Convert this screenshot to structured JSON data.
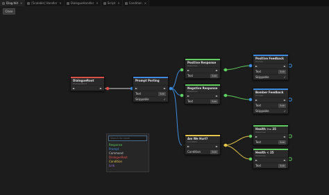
{
  "tabs": [
    {
      "label": "Diag.tkit",
      "active": true
    },
    {
      "label": "[Scalable] Handler",
      "active": false
    },
    {
      "label": "DialogueHandler",
      "active": false
    },
    {
      "label": "Script",
      "active": false
    },
    {
      "label": "Condition",
      "active": false
    }
  ],
  "close_label": "Close",
  "nodes": {
    "root": {
      "title": "DialogueRoot",
      "subtitle": "DialogueRoot",
      "color": "#e0504a"
    },
    "prompt": {
      "title": "Prompt Porting",
      "subtitle": "",
      "text_label": "Text",
      "edit": "Edit",
      "skippable": "Skippable",
      "color": "#3d8ee0"
    },
    "pos_resp": {
      "title": "Positive Response",
      "subtitle": "Response",
      "text_label": "Text",
      "edit": "Edit",
      "color": "#5fd05f"
    },
    "neg_resp": {
      "title": "Negative Response",
      "subtitle": "Response",
      "text_label": "Text",
      "edit": "Edit",
      "color": "#5fd05f"
    },
    "pos_fb": {
      "title": "Positive Feedback",
      "subtitle": "Prompt",
      "text_label": "Text",
      "edit": "Edit",
      "skippable": "Skippable",
      "color": "#3d8ee0"
    },
    "neg_fb": {
      "title": "Bomber Feedback",
      "subtitle": "Prompt",
      "text_label": "Text",
      "edit": "Edit",
      "skippable": "Skippable",
      "color": "#3d8ee0"
    },
    "am_hurt": {
      "title": "Am We Hurt?",
      "subtitle": "Condition",
      "cond_label": "Condition",
      "edit": "Edit",
      "color": "#e8c84a"
    },
    "health1": {
      "title": "Health >= 25",
      "subtitle": "Response",
      "text_label": "Text",
      "edit": "Edit",
      "color": "#5fd05f"
    },
    "health2": {
      "title": "Health < 25",
      "subtitle": "Response",
      "text_label": "Text",
      "edit": "Edit",
      "color": "#5fd05f"
    }
  },
  "context_menu": {
    "search_placeholder": "Search for node",
    "items": [
      {
        "label": "Response",
        "color": "#5fd05f"
      },
      {
        "label": "Prompt",
        "color": "#3d8ee0"
      },
      {
        "label": "Command",
        "color": "#d0d0d0"
      },
      {
        "label": "DialogueRoot",
        "color": "#e0504a"
      },
      {
        "label": "Condition",
        "color": "#e8c84a"
      },
      {
        "label": "Link",
        "color": "#9a6ae0"
      }
    ]
  }
}
